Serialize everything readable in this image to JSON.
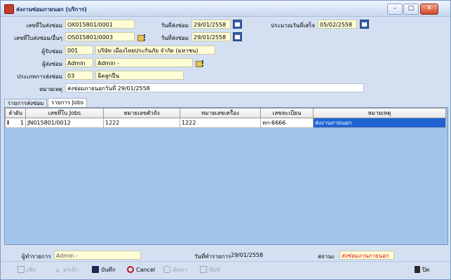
{
  "window": {
    "title": "ส่งงานซ่อมภายนอก (บริการ)",
    "min": "–",
    "max": "□",
    "close": "✕"
  },
  "form": {
    "job_no_label": "เลขที่ใบส่งซ่อม",
    "job_no": "OX015801/0001",
    "send_date_label": "วันที่ส่งซ่อม",
    "send_date": "29/01/2558",
    "est_date_label": "ประมาณวันที่เสร็จ",
    "est_date": "05/02/2558",
    "ref_label": "เลขที่ใบส่งซ่อม/อื่นๆ",
    "ref": "OS015801/0003",
    "ref_date_label": "วันที่ส่งซ่อม",
    "ref_date": "29/01/2558",
    "receiver_label": "ผู้รับซ่อม",
    "receiver_code": "001",
    "receiver_name": "บริษัท เมืองไทยประกันภัย จำกัด (มหาชน)",
    "sender_label": "ผู้ส่งซ่อม",
    "sender_code": "Admin",
    "sender_name": "Admin -",
    "type_label": "ประเภทการส่งซ่อม",
    "type_code": "03",
    "type_name": "ฉีดลูกปืน",
    "note_label": "หมายเหตุ",
    "note": "ส่งซ่อมภายนอกวันที่ 29/01/2558"
  },
  "tabs": [
    "รายการส่งซ่อม",
    "รายการ Jobs"
  ],
  "grid": {
    "columns": [
      "ลำดับ",
      "เลขที่ใบ Jobs",
      "หมายเลขตัวถัง",
      "หมายเลขเครื่อง",
      "เลขทะเบียน",
      "หมายเหตุ"
    ],
    "rows": [
      {
        "marker": "I",
        "no": "1",
        "job": "JN015801/0012",
        "chassis": "1222",
        "engine": "1222",
        "plate": "หก-6666",
        "remark": "ส่งงานภายนอก"
      }
    ]
  },
  "status": {
    "user_label": "ผู้ทำรายการ",
    "user": "Admin -",
    "date_label": "วันที่ทำรายการ",
    "date": "29/01/2558",
    "state_label": "สถานะ",
    "state": "ส่งซ่อมงานภายนอก"
  },
  "toolbar": {
    "add": "เพิ่ม",
    "cancel_doc": "ยกเลิก",
    "save": "บันทึก",
    "cancel": "Cancel",
    "search": "ค้นหา",
    "print": "พิมพ์",
    "close": "ปิด"
  },
  "colors": {
    "field_bg": "#fffdd6",
    "grid_bg": "#a3c4ea",
    "selection": "#1f63d2",
    "status_red": "#e01010"
  }
}
